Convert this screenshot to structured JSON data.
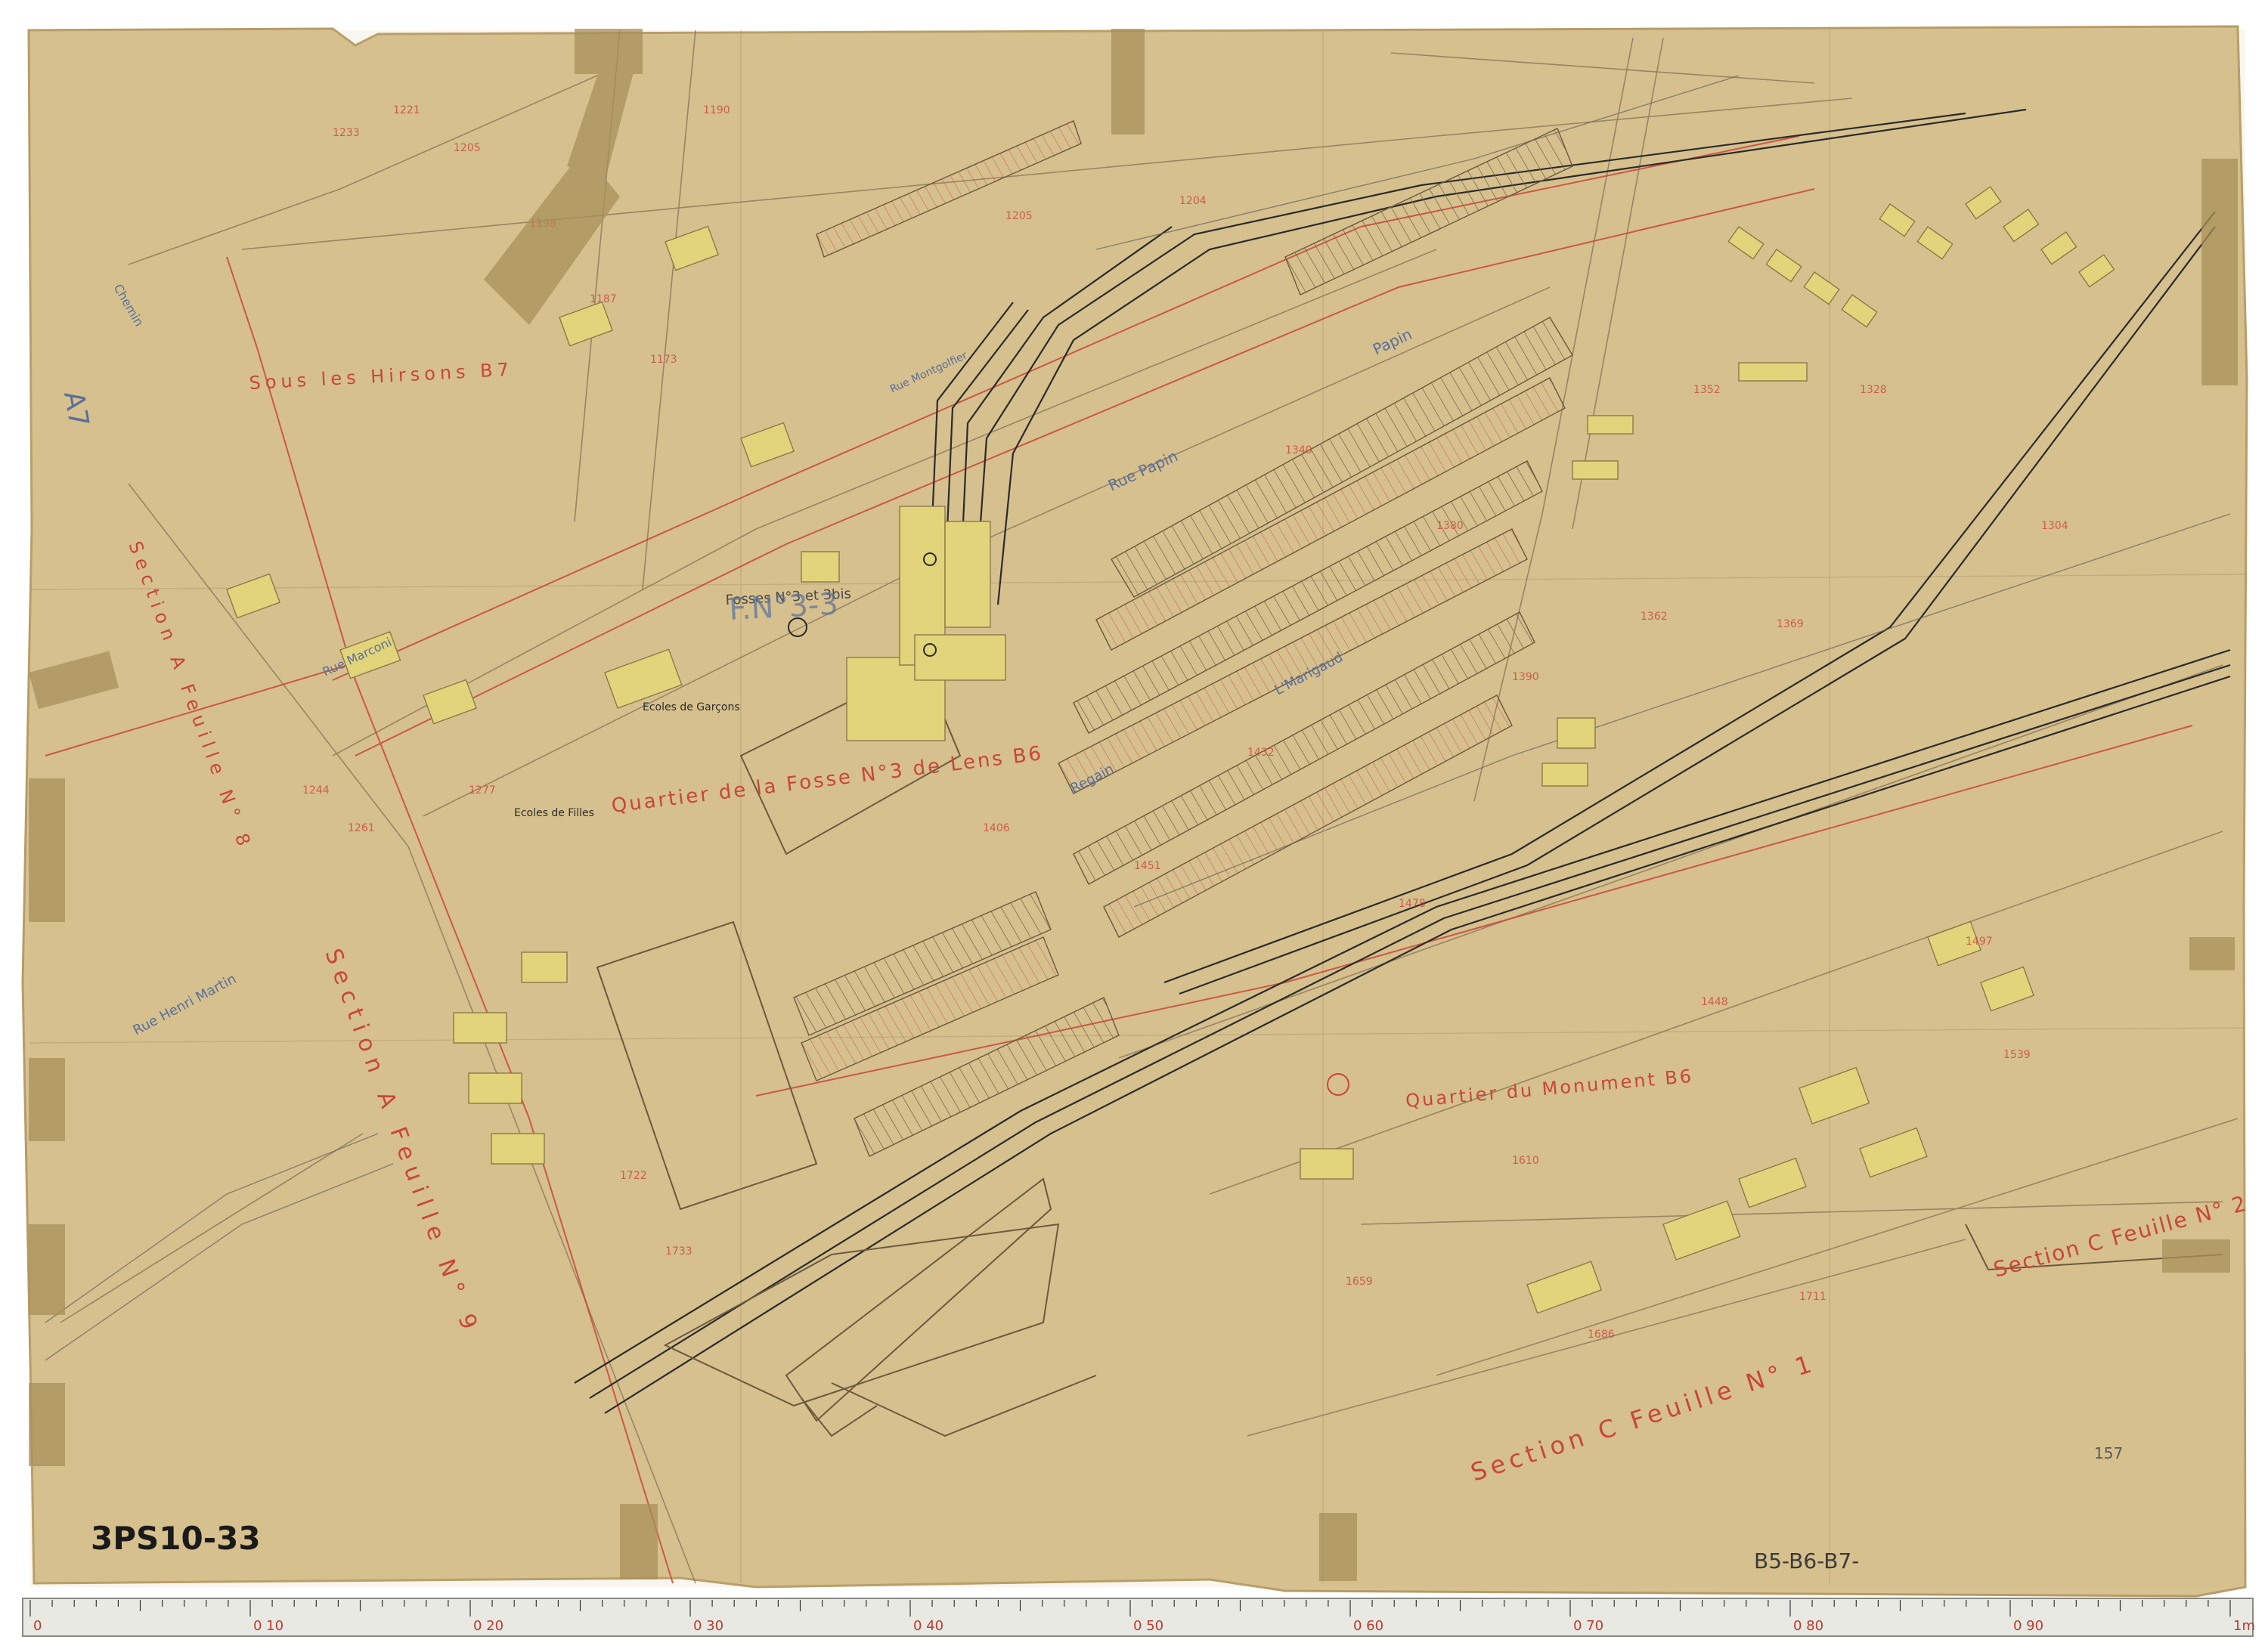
{
  "archive_ref": "3PS10-33",
  "sheet_refs": "B5-B6-B7-",
  "sheet_number": "157",
  "districts": {
    "sous_les_hirsons": "Sous les Hirsons B7",
    "quartier_fosse": "Quartier de la Fosse N°3 de Lens B6",
    "quartier_monument": "Quartier du Monument B6",
    "grid_a7": "A7"
  },
  "pit": {
    "label_small": "Fosses N°3 et 3bis",
    "label_large": "F.N°3-3"
  },
  "sections": {
    "section_a_feuille_9": "Section A Feuille N° 9",
    "section_a_feuille_8": "Section A Feuille N° 8",
    "section_c_feuille_1": "Section C Feuille N° 1",
    "section_c_feuille_2": "Section C Feuille N° 2"
  },
  "buildings": {
    "ecoles_garcons": "Ecoles de Garçons",
    "ecoles_filles": "Ecoles de Filles"
  },
  "streets": {
    "rue_papin": "Rue Papin",
    "rue_papin_2": "Papin",
    "rue_montgolfier": "Rue Montgolfier",
    "rue_marconi": "Rue Marconi",
    "rue_henri_martin": "Rue Henri Martin",
    "rue_marigaud": "L'Marigaud",
    "rue_regain": "Regain",
    "chemin": "Chemin"
  },
  "ruler": {
    "labels": [
      "0",
      "0 10",
      "0 20",
      "0 30",
      "0 40",
      "0 50",
      "0 60",
      "0 70",
      "0 80",
      "0 90",
      "1m"
    ]
  },
  "colors": {
    "paper": "#d8c291",
    "paper_dark": "#c9ae76",
    "ink_black": "#2b2b2b",
    "ink_red": "#c8463a",
    "ink_blue": "#5a6f9a",
    "house_yellow": "#e2d47a",
    "tape": "#a8905a"
  }
}
